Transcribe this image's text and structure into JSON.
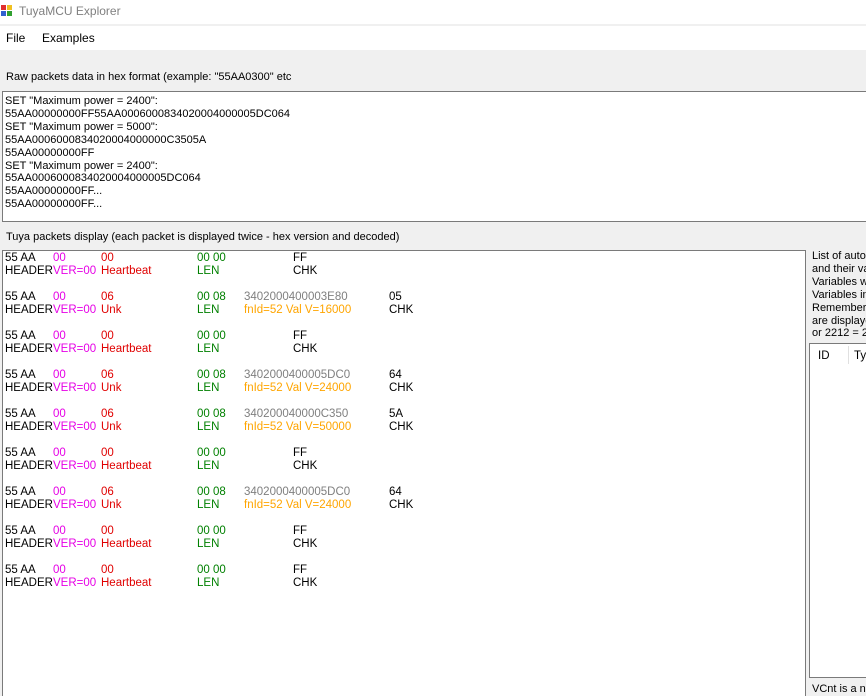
{
  "window": {
    "title": "TuyaMCU Explorer"
  },
  "menu": {
    "file": "File",
    "examples": "Examples"
  },
  "raw_section": {
    "label": "Raw packets data in hex format (example: \"55AA0300\" etc",
    "content": "SET \"Maximum power = 2400\":\n55AA00000000FF55AA0006000834020004000005DC064\nSET \"Maximum power = 5000\":\n55AA0006000834020004000000C3505A\n55AA00000000FF\nSET \"Maximum power = 2400\":\n55AA0006000834020004000005DC064\n55AA00000000FF...\n55AA00000000FF..."
  },
  "packets_section": {
    "label": "Tuya packets display (each packet is displayed twice - hex version and decoded)",
    "packets": [
      {
        "hex": [
          "55 AA",
          "00",
          "00",
          "00 00",
          "",
          "FF"
        ],
        "dec": [
          "HEADER",
          "VER=00",
          "Heartbeat",
          "LEN",
          "",
          "CHK"
        ]
      },
      {
        "hex": [
          "55 AA",
          "00",
          "06",
          "00 08",
          "3402000400003E80",
          "05"
        ],
        "dec": [
          "HEADER",
          "VER=00",
          "Unk",
          "LEN",
          "fnId=52 Val V=16000",
          "CHK"
        ]
      },
      {
        "hex": [
          "55 AA",
          "00",
          "00",
          "00 00",
          "",
          "FF"
        ],
        "dec": [
          "HEADER",
          "VER=00",
          "Heartbeat",
          "LEN",
          "",
          "CHK"
        ]
      },
      {
        "hex": [
          "55 AA",
          "00",
          "06",
          "00 08",
          "3402000400005DC0",
          "64"
        ],
        "dec": [
          "HEADER",
          "VER=00",
          "Unk",
          "LEN",
          "fnId=52 Val V=24000",
          "CHK"
        ]
      },
      {
        "hex": [
          "55 AA",
          "00",
          "06",
          "00 08",
          "340200040000C350",
          "5A"
        ],
        "dec": [
          "HEADER",
          "VER=00",
          "Unk",
          "LEN",
          "fnId=52 Val V=50000",
          "CHK"
        ]
      },
      {
        "hex": [
          "55 AA",
          "00",
          "00",
          "00 00",
          "",
          "FF"
        ],
        "dec": [
          "HEADER",
          "VER=00",
          "Heartbeat",
          "LEN",
          "",
          "CHK"
        ]
      },
      {
        "hex": [
          "55 AA",
          "00",
          "06",
          "00 08",
          "3402000400005DC0",
          "64"
        ],
        "dec": [
          "HEADER",
          "VER=00",
          "Unk",
          "LEN",
          "fnId=52 Val V=24000",
          "CHK"
        ]
      },
      {
        "hex": [
          "55 AA",
          "00",
          "00",
          "00 00",
          "",
          "FF"
        ],
        "dec": [
          "HEADER",
          "VER=00",
          "Heartbeat",
          "LEN",
          "",
          "CHK"
        ]
      },
      {
        "hex": [
          "55 AA",
          "00",
          "00",
          "00 00",
          "",
          "FF"
        ],
        "dec": [
          "HEADER",
          "VER=00",
          "Heartbeat",
          "LEN",
          "",
          "CHK"
        ]
      }
    ]
  },
  "right_panel": {
    "help_lines": [
      "List of autom",
      "and their va",
      "Variables wi",
      "Variables in",
      "Remember",
      "are displaye",
      "or 2212 = 2"
    ],
    "columns": [
      "ID",
      "Ty"
    ],
    "bottom_note": "VCnt is a nu"
  },
  "colors": {
    "ver": "#e600e6",
    "cmd": "#e00000",
    "len": "#008000",
    "payload_hex": "#7f7f7f",
    "payload_dec": "#ffa500"
  },
  "icons": {
    "app": "tuya-app-icon"
  }
}
